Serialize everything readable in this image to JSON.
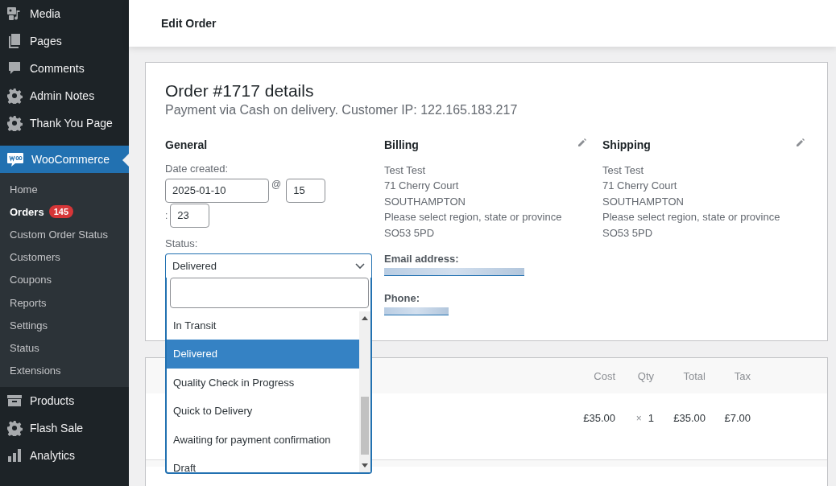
{
  "sidebar": {
    "items": [
      {
        "label": "Media",
        "kind": "media",
        "selected": false
      },
      {
        "label": "Pages",
        "kind": "pages",
        "selected": false
      },
      {
        "label": "Comments",
        "kind": "comment",
        "selected": false
      },
      {
        "label": "Admin Notes",
        "kind": "gear",
        "selected": false
      },
      {
        "label": "Thank You Page",
        "kind": "gear",
        "selected": false
      },
      {
        "label": "WooCommerce",
        "kind": "woo",
        "selected": true,
        "submenu": [
          {
            "label": "Home",
            "selected": false
          },
          {
            "label": "Orders",
            "selected": true,
            "badge": "145"
          },
          {
            "label": "Custom Order Status",
            "selected": false
          },
          {
            "label": "Customers",
            "selected": false
          },
          {
            "label": "Coupons",
            "selected": false
          },
          {
            "label": "Reports",
            "selected": false
          },
          {
            "label": "Settings",
            "selected": false
          },
          {
            "label": "Status",
            "selected": false
          },
          {
            "label": "Extensions",
            "selected": false
          }
        ]
      },
      {
        "label": "Products",
        "kind": "box",
        "selected": false
      },
      {
        "label": "Flash Sale",
        "kind": "gear",
        "selected": false
      },
      {
        "label": "Analytics",
        "kind": "bars",
        "selected": false
      }
    ]
  },
  "header": {
    "title": "Edit Order"
  },
  "order": {
    "title": "Order #1717 details",
    "subtitle": "Payment via Cash on delivery. Customer IP: 122.165.183.217",
    "general": {
      "heading": "General",
      "date_label": "Date created:",
      "date": "2025-01-10",
      "at": "@",
      "hour": "15",
      "colon": ":",
      "minute": "23",
      "status_label": "Status:",
      "status": {
        "value": "Delivered",
        "expanded": true,
        "options": [
          {
            "label": "In Transit",
            "selected": false
          },
          {
            "label": "Delivered",
            "selected": true
          },
          {
            "label": "Quality Check in Progress",
            "selected": false
          },
          {
            "label": "Quick to Delivery",
            "selected": false
          },
          {
            "label": "Awaiting for payment confirmation",
            "selected": false
          },
          {
            "label": "Draft",
            "selected": false
          }
        ]
      }
    },
    "billing": {
      "heading": "Billing",
      "lines": [
        "Test Test",
        "71 Cherry Court",
        "SOUTHAMPTON",
        "Please select region, state or province",
        "SO53 5PD"
      ],
      "email_label": "Email address:",
      "phone_label": "Phone:"
    },
    "shipping": {
      "heading": "Shipping",
      "lines": [
        "Test Test",
        "71 Cherry Court",
        "SOUTHAMPTON",
        "Please select region, state or province",
        "SO53 5PD"
      ]
    }
  },
  "items": {
    "columns": [
      "Cost",
      "Qty",
      "Total",
      "Tax"
    ],
    "rows": [
      {
        "cost": "£35.00",
        "times": "×",
        "qty": "1",
        "total": "£35.00",
        "tax": "£7.00"
      }
    ]
  }
}
